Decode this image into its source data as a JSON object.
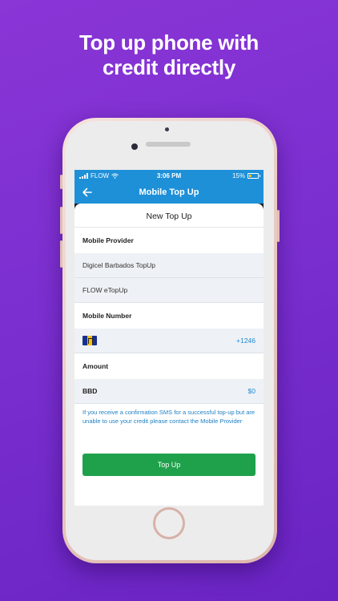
{
  "headline": {
    "line1": "Top up phone with",
    "line2": "credit directly"
  },
  "colors": {
    "background": "#7b2fd0",
    "app_bar": "#1e90d8",
    "button": "#1fa14b",
    "link_text": "#1e7fc4"
  },
  "status_bar": {
    "carrier": "FLOW",
    "time": "3:06 PM",
    "battery": "15%"
  },
  "nav": {
    "title": "Mobile Top Up",
    "back_icon": "arrow-left-icon"
  },
  "sheet": {
    "title": "New Top Up",
    "provider_label": "Mobile Provider",
    "providers": [
      "Digicel Barbados TopUp",
      "FLOW eTopUp"
    ],
    "number_label": "Mobile Number",
    "number_flag": "barbados-flag-icon",
    "number_code": "+1246",
    "amount_label": "Amount",
    "currency": "BBD",
    "amount_value": "$0",
    "info": "If you receive a confirmation SMS for a successful top-up but are unable to use your credit please contact the  Mobile Provider",
    "button_label": "Top Up"
  }
}
